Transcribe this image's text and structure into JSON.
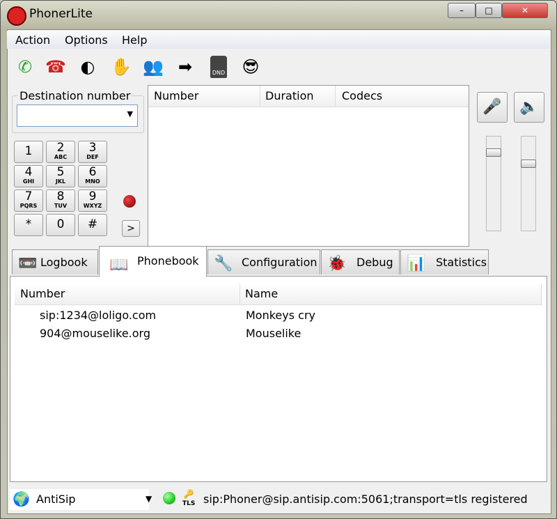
{
  "window": {
    "title": "PhonerLite",
    "minimize": "–",
    "maximize": "□",
    "close": "✕",
    "close_color": "#c43b2f"
  },
  "menu": [
    "Action",
    "Options",
    "Help"
  ],
  "toolbar": [
    {
      "name": "call-icon",
      "glyph": "✆"
    },
    {
      "name": "hangup-icon",
      "glyph": "☎"
    },
    {
      "name": "hold-icon",
      "glyph": "◐"
    },
    {
      "name": "hand-icon",
      "glyph": "✋"
    },
    {
      "name": "conference-icon",
      "glyph": "👥"
    },
    {
      "name": "transfer-icon",
      "glyph": "➡"
    },
    {
      "name": "dnd-icon",
      "glyph": "DND"
    },
    {
      "name": "smiley-icon",
      "glyph": "😎"
    }
  ],
  "destination": {
    "label": "Destination number",
    "value": ""
  },
  "keypad": [
    [
      "1",
      ""
    ],
    [
      "2",
      "ABC"
    ],
    [
      "3",
      "DEF"
    ],
    [
      "4",
      "GHI"
    ],
    [
      "5",
      "JKL"
    ],
    [
      "6",
      "MNO"
    ],
    [
      "7",
      "PQRS"
    ],
    [
      "8",
      "TUV"
    ],
    [
      "9",
      "WXYZ"
    ],
    [
      "*",
      ""
    ],
    [
      "0",
      ""
    ],
    [
      "#",
      ""
    ]
  ],
  "arrow_button": ">",
  "call_list": {
    "columns": [
      "Number",
      "Duration",
      "Codecs"
    ],
    "rows": []
  },
  "tabs": [
    {
      "label": "Logbook",
      "icon": "📼"
    },
    {
      "label": "Phonebook",
      "icon": "📖",
      "active": true
    },
    {
      "label": "Configuration",
      "icon": "🔧"
    },
    {
      "label": "Debug",
      "icon": "🐞"
    },
    {
      "label": "Statistics",
      "icon": "📊"
    }
  ],
  "phonebook": {
    "columns": [
      "Number",
      "Name"
    ],
    "rows": [
      [
        "sip:1234@loligo.com",
        "Monkeys cry"
      ],
      [
        "904@mouselike.org",
        "Mouselike"
      ]
    ]
  },
  "status": {
    "account": "AntiSip",
    "tls": "TLS",
    "text": "sip:Phoner@sip.antisip.com:5061;transport=tls registered",
    "indicator_color": "#22cc22"
  }
}
